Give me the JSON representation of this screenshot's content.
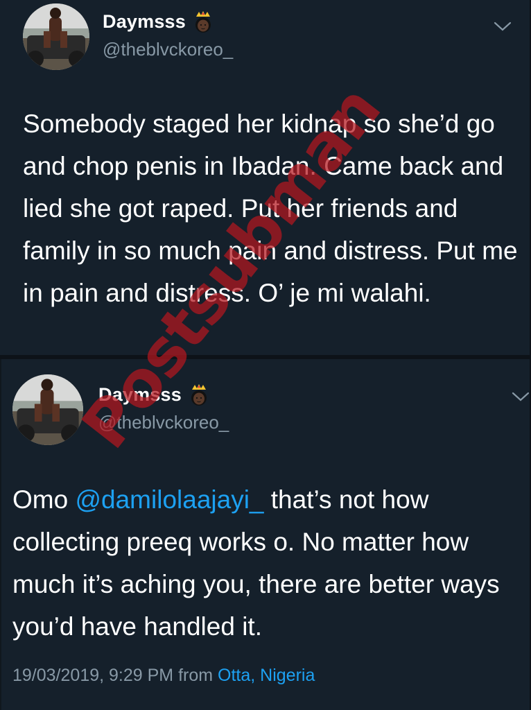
{
  "tweets": [
    {
      "display_name": "Daymsss",
      "handle": "@theblvckoreo_",
      "body": "Somebody staged her kidnap so she’d go and chop penis in Ibadan. Came back and lied she got raped. Put her friends and family in so much pain and distress. Put me in pain and distress. O’ je mi walahi."
    },
    {
      "display_name": "Daymsss",
      "handle": "@theblvckoreo_",
      "body_before": "Omo ",
      "mention": "@damilolaajayi_",
      "body_after": " that’s not how collecting preeq works o. No matter how much it’s aching you, there are better ways you’d have handled it.",
      "timestamp": "19/03/2019, 9:29 PM",
      "from_label": "from",
      "location": "Otta, Nigeria"
    }
  ],
  "watermark": "Postsubman",
  "icons": {
    "crown": "princess-emoji-icon",
    "chevron": "chevron-down-icon"
  },
  "colors": {
    "background": "#15202b",
    "link": "#1da1f2",
    "secondary_text": "#8899a6",
    "watermark": "#b4161e"
  }
}
